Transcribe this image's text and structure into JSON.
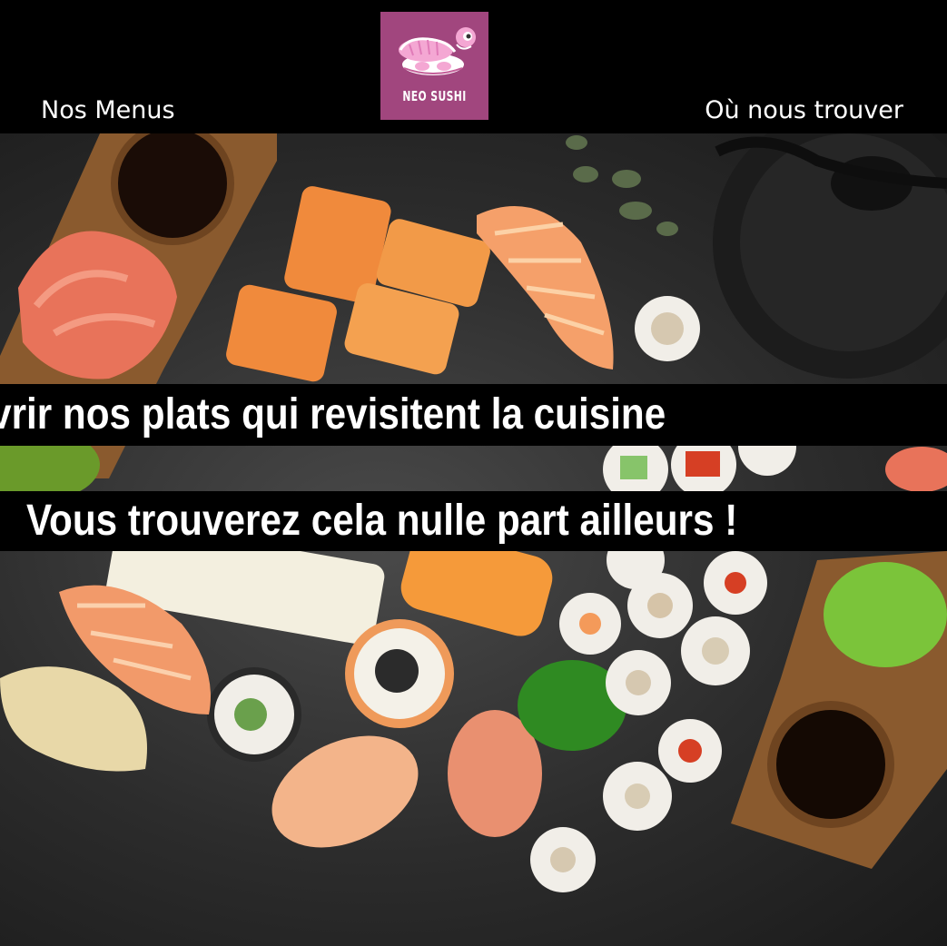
{
  "header": {
    "nav_left": "Nos Menus",
    "nav_right": "Où nous trouver",
    "logo_text": "NEO SUSHI"
  },
  "hero": {
    "banner_1": "couvrir nos plats qui revisitent la cuisine",
    "banner_2": "Vous trouverez cela nulle part ailleurs !"
  },
  "colors": {
    "header_bg": "#000000",
    "logo_bg": "#a1467e",
    "text": "#ffffff",
    "banner_bg": "#000000"
  }
}
